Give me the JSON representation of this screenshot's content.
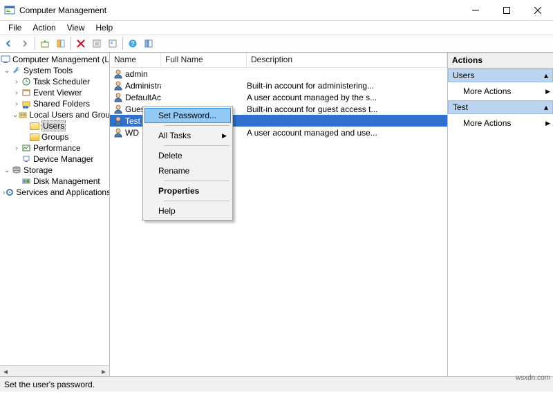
{
  "window": {
    "title": "Computer Management"
  },
  "menu": {
    "file": "File",
    "action": "Action",
    "view": "View",
    "help": "Help"
  },
  "tree": {
    "root": "Computer Management (Local",
    "systools": "System Tools",
    "task": "Task Scheduler",
    "event": "Event Viewer",
    "shared": "Shared Folders",
    "lug": "Local Users and Groups",
    "users": "Users",
    "groups": "Groups",
    "perf": "Performance",
    "devmgr": "Device Manager",
    "storage": "Storage",
    "diskmgmt": "Disk Management",
    "services": "Services and Applications"
  },
  "list": {
    "cols": {
      "name": "Name",
      "full": "Full Name",
      "desc": "Description"
    },
    "rows": [
      {
        "name": "admin",
        "full": "",
        "desc": ""
      },
      {
        "name": "Administrator",
        "full": "",
        "desc": "Built-in account for administering..."
      },
      {
        "name": "DefaultAcco",
        "full": "",
        "desc": "A user account managed by the s..."
      },
      {
        "name": "Guest",
        "full": "",
        "desc": "Built-in account for guest access t..."
      },
      {
        "name": "Test",
        "full": "",
        "desc": ""
      },
      {
        "name": "WD",
        "full": "",
        "desc": "A user account managed and use..."
      }
    ]
  },
  "ctx": {
    "setpw": "Set Password...",
    "alltasks": "All Tasks",
    "delete": "Delete",
    "rename": "Rename",
    "props": "Properties",
    "help": "Help"
  },
  "actions": {
    "header": "Actions",
    "g1": "Users",
    "more": "More Actions",
    "g2": "Test"
  },
  "status": "Set the user's password.",
  "wm": "wsxdn.com"
}
